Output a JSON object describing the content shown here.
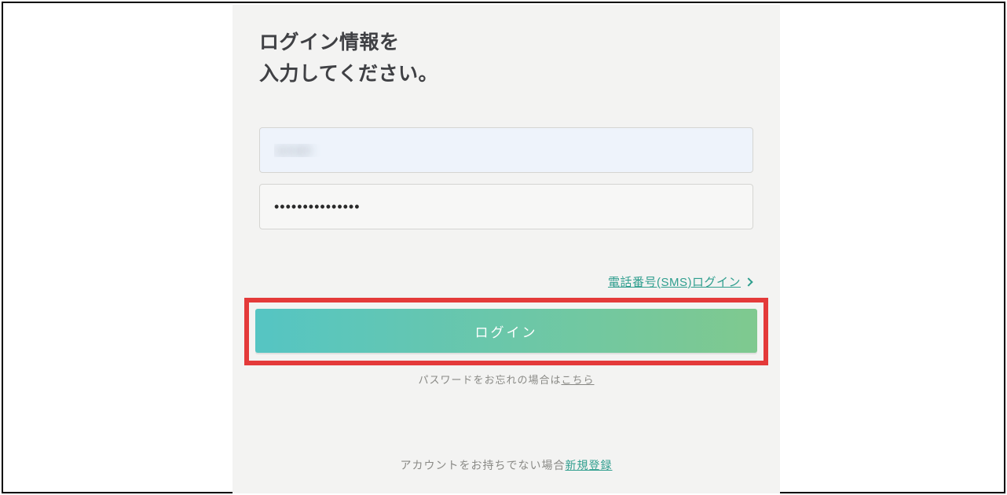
{
  "heading": {
    "line1": "ログイン情報を",
    "line2": "入力してください。"
  },
  "form": {
    "username_value": "sample",
    "password_value": "•••••••••••••••"
  },
  "sms_login_label": "電話番号(SMS)ログイン",
  "login_button_label": "ログイン",
  "forgot": {
    "prefix": "パスワードをお忘れの場合は",
    "link": "こちら"
  },
  "signup": {
    "prefix": "アカウントをお持ちでない場合",
    "link": "新規登録"
  },
  "colors": {
    "accent": "#2f9e8e",
    "highlight_border": "#e43a3a"
  }
}
